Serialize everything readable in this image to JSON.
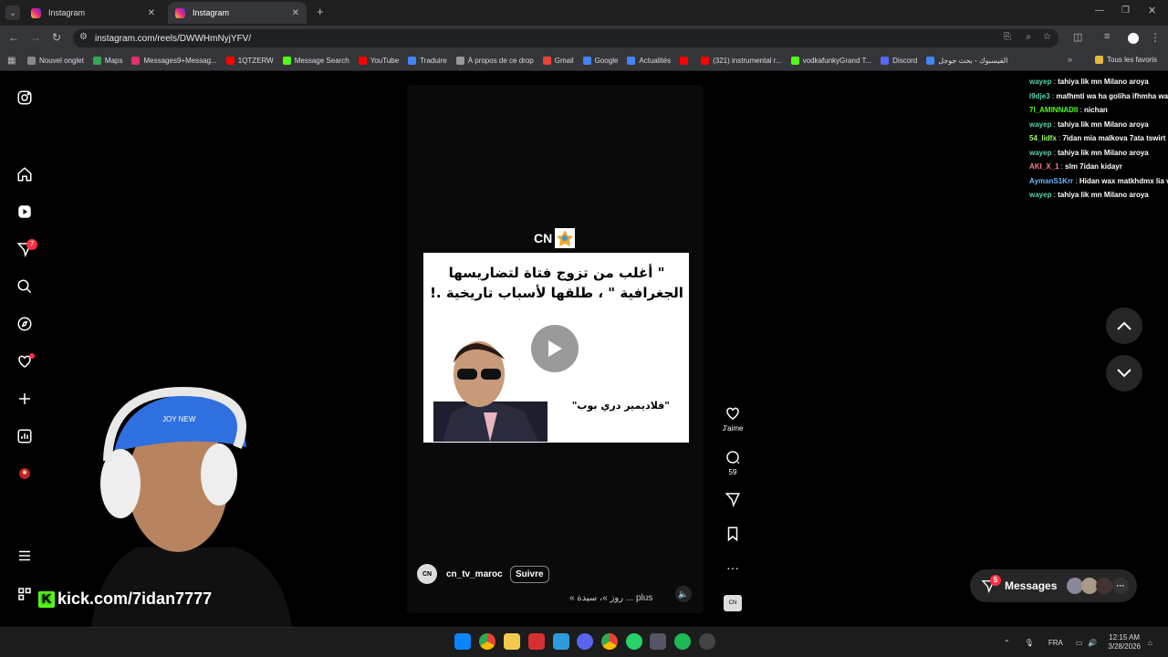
{
  "browser": {
    "tabs": [
      {
        "title": "Instagram"
      },
      {
        "title": "Instagram"
      }
    ],
    "url": "instagram.com/reels/DWWHmNyjYFV/",
    "bookmarks": [
      {
        "label": "Nouvel onglet",
        "color": "#888"
      },
      {
        "label": "Maps",
        "color": "#34a853"
      },
      {
        "label": "Messages9+Messag...",
        "color": "#e1306c"
      },
      {
        "label": "1QTZERW",
        "color": "#ff0000"
      },
      {
        "label": "Message Search",
        "color": "#53fc18"
      },
      {
        "label": "YouTube",
        "color": "#ff0000"
      },
      {
        "label": "Traduire",
        "color": "#4285f4"
      },
      {
        "label": "À propos de ce drop",
        "color": "#999"
      },
      {
        "label": "Gmail",
        "color": "#ea4335"
      },
      {
        "label": "Google",
        "color": "#4285f4"
      },
      {
        "label": "Actualités",
        "color": "#4285f4"
      },
      {
        "label": "",
        "color": "#ff0000"
      },
      {
        "label": "(321) instrumental r...",
        "color": "#ff0000"
      },
      {
        "label": "vodkafunkyGrand T...",
        "color": "#53fc18"
      },
      {
        "label": "Discord",
        "color": "#5865f2"
      },
      {
        "label": "الفيسبوك - بحث جوجل",
        "color": "#4285f4"
      }
    ],
    "all_bookmarks": "Tous les favoris"
  },
  "sidebar": {
    "notif_count": "7"
  },
  "reel": {
    "channel_logo": "CN",
    "quote": "\" أغلب من تزوج فتاة لتضاريسها الجغرافية \" ، طلقها لأسباب تاريخية .!",
    "subtitle": "\"فلاديمير دري بوب\"",
    "username": "cn_tv_maroc",
    "follow_label": "Suivre",
    "caption": "« روز »، سيدة ... plus",
    "avatar_text": "CN"
  },
  "actions": {
    "like_label": "J'aime",
    "comment_count": "59"
  },
  "chat": [
    {
      "user": "wayep",
      "color": "#5fd3a6",
      "msg": "tahiya lik mn Milano aroya"
    },
    {
      "user": "l9dje3",
      "color": "#5fd3a6",
      "msg": "mafhmti wa ha goliha ifhmha wa"
    },
    {
      "user": "7l_AMINNADII",
      "color": "#53fc18",
      "msg": "nichan"
    },
    {
      "user": "wayep",
      "color": "#5fd3a6",
      "msg": "tahiya lik mn Milano aroya"
    },
    {
      "user": "54_lidfx",
      "color": "#9cff6a",
      "msg": "7idan mia malkova 7ata tswirt"
    },
    {
      "user": "wayep",
      "color": "#5fd3a6",
      "msg": "tahiya lik mn Milano aroya"
    },
    {
      "user": "AKI_X_1",
      "color": "#ff7b8a",
      "msg": "slm 7idan kidayr"
    },
    {
      "user": "AymanS1Krr",
      "color": "#6ab7ff",
      "msg": "Hidan wax matkhdmx lia v"
    },
    {
      "user": "wayep",
      "color": "#5fd3a6",
      "msg": "tahiya lik mn Milano aroya"
    }
  ],
  "messages": {
    "label": "Messages",
    "count": "5"
  },
  "overlay": {
    "kick_text": "kick.com/7idan7777"
  },
  "taskbar": {
    "lang": "FRA",
    "time": "12:15 AM",
    "date": "3/28/2026"
  }
}
